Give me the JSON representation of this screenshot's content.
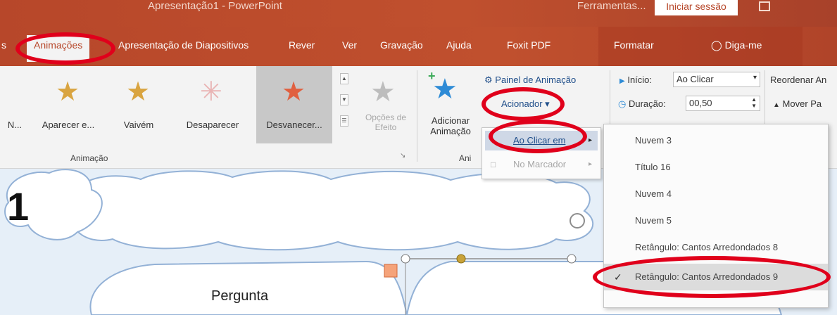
{
  "titlebar": {
    "doc_title": "Apresentação1 - PowerPoint",
    "user": "Ferramentas...",
    "signin": "Iniciar sessão"
  },
  "tabs": [
    {
      "label": "s"
    },
    {
      "label": "Animações"
    },
    {
      "label": "Apresentação de Diapositivos"
    },
    {
      "label": "Rever"
    },
    {
      "label": "Ver"
    },
    {
      "label": "Gravação"
    },
    {
      "label": "Ajuda"
    },
    {
      "label": "Foxit PDF"
    },
    {
      "label": "Formatar"
    },
    {
      "label": "Diga-me"
    }
  ],
  "animation_gallery": {
    "items": [
      {
        "label": "N...",
        "color": "#9a9a9a"
      },
      {
        "label": "Aparecer e...",
        "letter": "B",
        "color": "#d9a440"
      },
      {
        "label": "Vaivém",
        "letter": "A",
        "color": "#d9a440"
      },
      {
        "label": "Desaparecer",
        "color": "#e7a0a0"
      },
      {
        "label": "Desvanecer...",
        "color": "#e06040"
      }
    ],
    "group_label": "Animação",
    "effect_options": "Opções de Efeito"
  },
  "advanced": {
    "add_animation": "Adicionar Animação",
    "animation_pane": "Painel de Animação",
    "trigger": "Acionador",
    "group_label_partial": "Ani"
  },
  "timing": {
    "start_label": "Início:",
    "start_value": "Ao Clicar",
    "duration_label": "Duração:",
    "duration_value": "00,50",
    "reorder_label": "Reordenar An",
    "move_label": "Mover Pa"
  },
  "trigger_menu": {
    "items": [
      {
        "label": "Ao Clicar em"
      },
      {
        "label": "No Marcador"
      }
    ]
  },
  "submenu": {
    "items": [
      {
        "label": "Nuvem 3"
      },
      {
        "label": "Título 16"
      },
      {
        "label": "Nuvem 4"
      },
      {
        "label": "Nuvem 5"
      },
      {
        "label": "Retângulo: Cantos Arredondados 8"
      },
      {
        "label": "Retângulo: Cantos Arredondados 9",
        "checked": true
      }
    ]
  },
  "slide": {
    "number": "1",
    "question_text": "Pergunta"
  },
  "colors": {
    "accent": "#b7472a",
    "annotation_red": "#e0001b",
    "slide_bg": "#dae8f5"
  }
}
